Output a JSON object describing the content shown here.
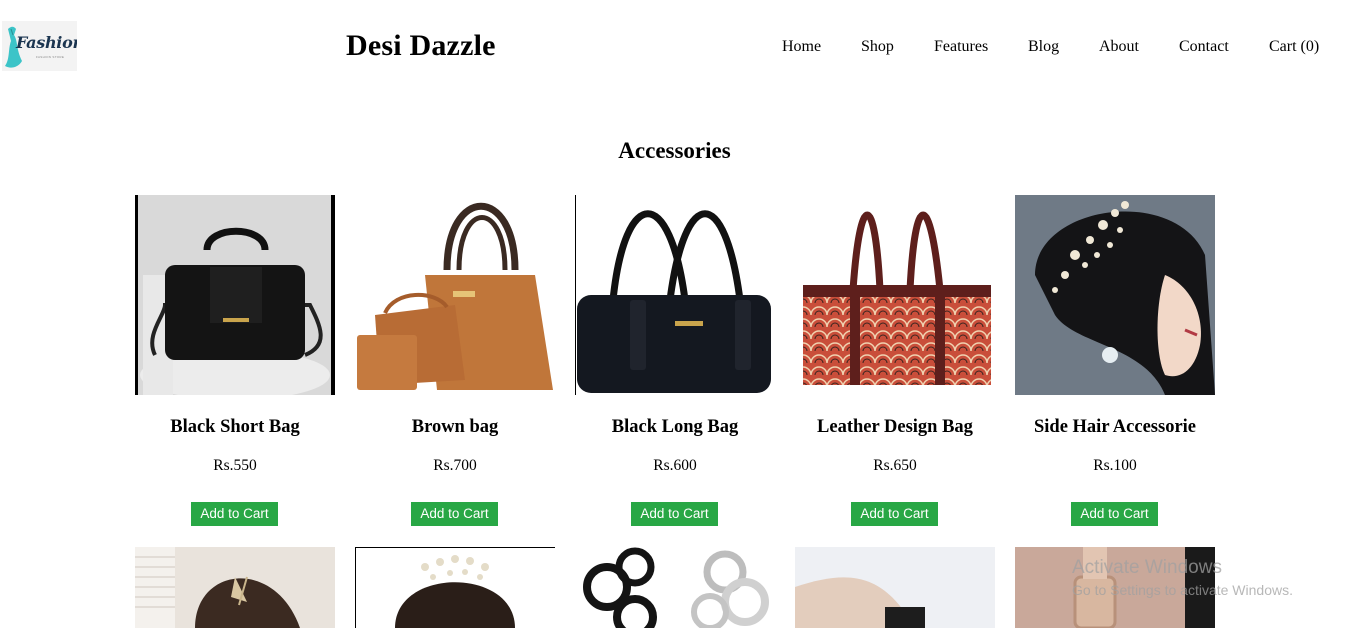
{
  "brand": {
    "logo_text": "Fashion",
    "logo_sub": "FASHION STORE",
    "site_title": "Desi Dazzle"
  },
  "nav": {
    "items": [
      "Home",
      "Shop",
      "Features",
      "Blog",
      "About",
      "Contact",
      "Cart (0)"
    ]
  },
  "section": {
    "title": "Accessories"
  },
  "products": [
    {
      "name": "Black Short Bag",
      "price": "Rs.550",
      "button": "Add to Cart",
      "image_icon": "black-handbag-image"
    },
    {
      "name": "Brown bag",
      "price": "Rs.700",
      "button": "Add to Cart",
      "image_icon": "brown-bag-set-image"
    },
    {
      "name": "Black Long Bag",
      "price": "Rs.600",
      "button": "Add to Cart",
      "image_icon": "black-long-bag-image"
    },
    {
      "name": "Leather Design Bag",
      "price": "Rs.650",
      "button": "Add to Cart",
      "image_icon": "patterned-bag-image"
    },
    {
      "name": "Side Hair Accessorie",
      "price": "Rs.100",
      "button": "Add to Cart",
      "image_icon": "hair-accessory-image"
    }
  ],
  "row2_images": [
    "hair-clip-image",
    "hair-comb-image",
    "bangles-image",
    "wrist-watch-image",
    "rose-gold-watch-image"
  ],
  "watermark": {
    "line1": "Activate Windows",
    "line2": "Go to Settings to activate Windows."
  },
  "colors": {
    "button": "#28a745",
    "button_text": "#ffffff",
    "logo_text": "#1b3550",
    "logo_accent": "#3cc4c8"
  }
}
